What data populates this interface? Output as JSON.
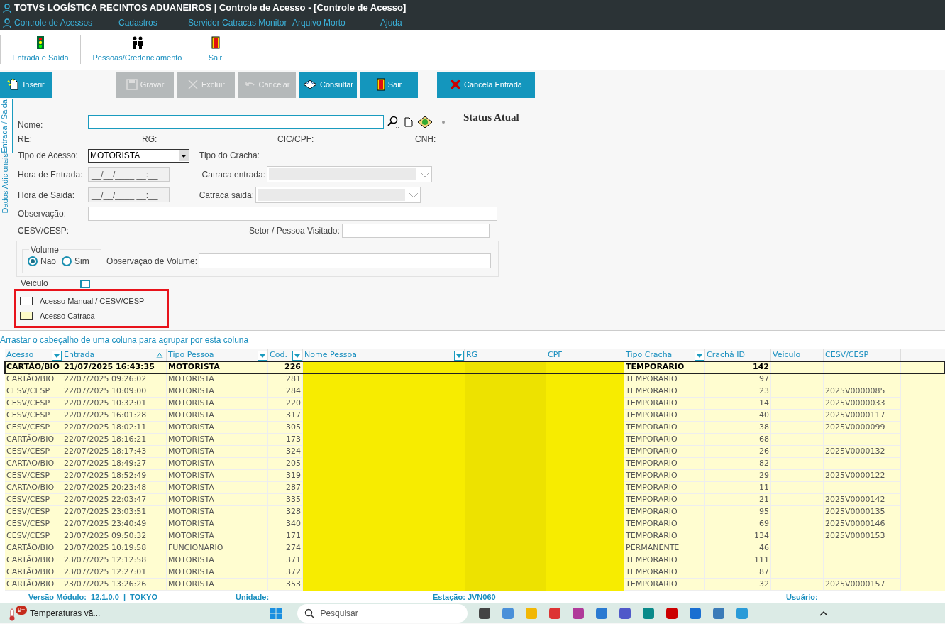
{
  "window": {
    "title": "TOTVS LOGÍSTICA RECINTOS ADUANEIROS | Controle de Acesso - [Controle de Acesso]"
  },
  "menu": [
    "Controle de Acessos",
    "Cadastros",
    "Servidor Catracas Monitor",
    "Arquivo Morto",
    "Ajuda"
  ],
  "toolbar": [
    {
      "label": "Entrada e Saída",
      "kind": "traffic"
    },
    {
      "label": "Pessoas/Credenciamento",
      "kind": "people"
    },
    {
      "label": "Sair",
      "kind": "exit"
    }
  ],
  "actions": [
    {
      "label": "Inserir",
      "kind": "insert",
      "disabled": false
    },
    {
      "label": "Gravar",
      "kind": "save",
      "disabled": true
    },
    {
      "label": "Excluir",
      "kind": "delete",
      "disabled": true
    },
    {
      "label": "Cancelar",
      "kind": "undo",
      "disabled": true
    },
    {
      "label": "Consultar",
      "kind": "book",
      "disabled": false
    },
    {
      "label": "Sair",
      "kind": "exit",
      "disabled": false
    },
    {
      "label": "Cancela Entrada",
      "kind": "cancel",
      "disabled": false
    }
  ],
  "side_tabs": [
    {
      "label": "Entrada / Saida",
      "selected": true
    },
    {
      "label": "Dados Adicionais",
      "selected": false
    }
  ],
  "form": {
    "nome_label": "Nome:",
    "status_title": "Status Atual",
    "ids": [
      "RE:",
      "RG:",
      "CIC/CPF:",
      "CNH:"
    ],
    "tipo_acesso_label": "Tipo de Acesso:",
    "tipo_acesso": "MOTORISTA",
    "tipo_cracha_label": "Tipo do Cracha:",
    "hora_entrada_label": "Hora de Entrada:",
    "hora_entrada": "__/__/____ __:__",
    "catraca_entrada_label": "Catraca entrada:",
    "hora_saida_label": "Hora de Saida:",
    "hora_saida": "__/__/____ __:__",
    "catraca_saida_label": "Catraca saida:",
    "observacao_label": "Observação:",
    "cesv_label": "CESV/CESP:",
    "setor_label": "Setor / Pessoa Visitado:",
    "volume_title": "Volume",
    "volume_options": [
      {
        "label": "Não",
        "selected": true
      },
      {
        "label": "Sim",
        "selected": false
      }
    ],
    "obs_volume_label": "Observação de Volume:",
    "veiculo": {
      "label": "Veiculo",
      "checked": false
    },
    "legend": [
      {
        "label": "Acesso Manual / CESV/CESP",
        "color": "#ffffff"
      },
      {
        "label": "Acesso Catraca",
        "color": "#fdfbc8"
      }
    ]
  },
  "grid": {
    "group_hint": "Arrastar o cabeçalho de uma coluna para agrupar por esta coluna",
    "columns": [
      {
        "label": "Acesso",
        "kind": "filter"
      },
      {
        "label": "Entrada",
        "kind": "sort"
      },
      {
        "label": "Tipo Pessoa",
        "kind": "filter"
      },
      {
        "label": "Cod.",
        "kind": "filter"
      },
      {
        "label": "Nome Pessoa",
        "kind": "filter"
      },
      {
        "label": "RG",
        "kind": "plain"
      },
      {
        "label": "CPF",
        "kind": "plain"
      },
      {
        "label": "Tipo Cracha",
        "kind": "filter"
      },
      {
        "label": "Crachá ID",
        "kind": "plain"
      },
      {
        "label": "Veiculo",
        "kind": "plain"
      },
      {
        "label": "CESV/CESP",
        "kind": "plain"
      }
    ],
    "rows": [
      {
        "selected": true,
        "cells": [
          "CARTÃO/BIO",
          "21/07/2025 16:43:35",
          "MOTORISTA",
          "226",
          "",
          "",
          "",
          "TEMPORARIO",
          "142",
          "",
          ""
        ]
      },
      {
        "selected": false,
        "cells": [
          "CARTÃO/BIO",
          "22/07/2025 09:26:02",
          "MOTORISTA",
          "281",
          "",
          "",
          "",
          "TEMPORARIO",
          "97",
          "",
          ""
        ]
      },
      {
        "selected": false,
        "cells": [
          "CESV/CESP",
          "22/07/2025 10:09:00",
          "MOTORISTA",
          "284",
          "",
          "",
          "",
          "TEMPORARIO",
          "23",
          "",
          "2025V0000085"
        ]
      },
      {
        "selected": false,
        "cells": [
          "CESV/CESP",
          "22/07/2025 10:32:01",
          "MOTORISTA",
          "220",
          "",
          "",
          "",
          "TEMPORARIO",
          "14",
          "",
          "2025V0000033"
        ]
      },
      {
        "selected": false,
        "cells": [
          "CESV/CESP",
          "22/07/2025 16:01:28",
          "MOTORISTA",
          "317",
          "",
          "",
          "",
          "TEMPORARIO",
          "40",
          "",
          "2025V0000117"
        ]
      },
      {
        "selected": false,
        "cells": [
          "CESV/CESP",
          "22/07/2025 18:02:11",
          "MOTORISTA",
          "305",
          "",
          "",
          "",
          "TEMPORARIO",
          "38",
          "",
          "2025V0000099"
        ]
      },
      {
        "selected": false,
        "cells": [
          "CARTÃO/BIO",
          "22/07/2025 18:16:21",
          "MOTORISTA",
          "173",
          "",
          "",
          "",
          "TEMPORARIO",
          "68",
          "",
          ""
        ]
      },
      {
        "selected": false,
        "cells": [
          "CESV/CESP",
          "22/07/2025 18:17:43",
          "MOTORISTA",
          "324",
          "",
          "",
          "",
          "TEMPORARIO",
          "26",
          "",
          "2025V0000132"
        ]
      },
      {
        "selected": false,
        "cells": [
          "CARTÃO/BIO",
          "22/07/2025 18:49:27",
          "MOTORISTA",
          "205",
          "",
          "",
          "",
          "TEMPORARIO",
          "82",
          "",
          ""
        ]
      },
      {
        "selected": false,
        "cells": [
          "CESV/CESP",
          "22/07/2025 18:52:49",
          "MOTORISTA",
          "319",
          "",
          "",
          "",
          "TEMPORARIO",
          "29",
          "",
          "2025V0000122"
        ]
      },
      {
        "selected": false,
        "cells": [
          "CARTÃO/BIO",
          "22/07/2025 20:23:48",
          "MOTORISTA",
          "287",
          "",
          "",
          "",
          "TEMPORARIO",
          "11",
          "",
          ""
        ]
      },
      {
        "selected": false,
        "cells": [
          "CESV/CESP",
          "22/07/2025 22:03:47",
          "MOTORISTA",
          "335",
          "",
          "",
          "",
          "TEMPORARIO",
          "21",
          "",
          "2025V0000142"
        ]
      },
      {
        "selected": false,
        "cells": [
          "CESV/CESP",
          "22/07/2025 23:03:51",
          "MOTORISTA",
          "328",
          "",
          "",
          "",
          "TEMPORARIO",
          "95",
          "",
          "2025V0000135"
        ]
      },
      {
        "selected": false,
        "cells": [
          "CESV/CESP",
          "22/07/2025 23:40:49",
          "MOTORISTA",
          "340",
          "",
          "",
          "",
          "TEMPORARIO",
          "69",
          "",
          "2025V0000146"
        ]
      },
      {
        "selected": false,
        "cells": [
          "CESV/CESP",
          "23/07/2025 09:50:32",
          "MOTORISTA",
          "171",
          "",
          "",
          "",
          "TEMPORARIO",
          "134",
          "",
          "2025V0000153"
        ]
      },
      {
        "selected": false,
        "cells": [
          "CARTÃO/BIO",
          "23/07/2025 10:19:58",
          "FUNCIONARIO",
          "274",
          "",
          "",
          "",
          "PERMANENTE",
          "46",
          "",
          ""
        ]
      },
      {
        "selected": false,
        "cells": [
          "CARTÃO/BIO",
          "23/07/2025 12:12:58",
          "MOTORISTA",
          "371",
          "",
          "",
          "",
          "TEMPORARIO",
          "111",
          "",
          ""
        ]
      },
      {
        "selected": false,
        "cells": [
          "CARTÃO/BIO",
          "23/07/2025 12:27:01",
          "MOTORISTA",
          "372",
          "",
          "",
          "",
          "TEMPORARIO",
          "87",
          "",
          ""
        ]
      },
      {
        "selected": false,
        "cells": [
          "CARTÃO/BIO",
          "23/07/2025 13:26:26",
          "MOTORISTA",
          "353",
          "",
          "",
          "",
          "TEMPORARIO",
          "32",
          "",
          "2025V0000157"
        ]
      }
    ]
  },
  "status_bar": [
    "Versão Módulo:  12.1.0.0  |  TOKYO",
    "Unidade:",
    "Estação: JVN060",
    "Usuário:"
  ],
  "taskbar": {
    "weather": "Temperaturas vã...",
    "badge": "9+",
    "search_placeholder": "Pesquisar"
  }
}
